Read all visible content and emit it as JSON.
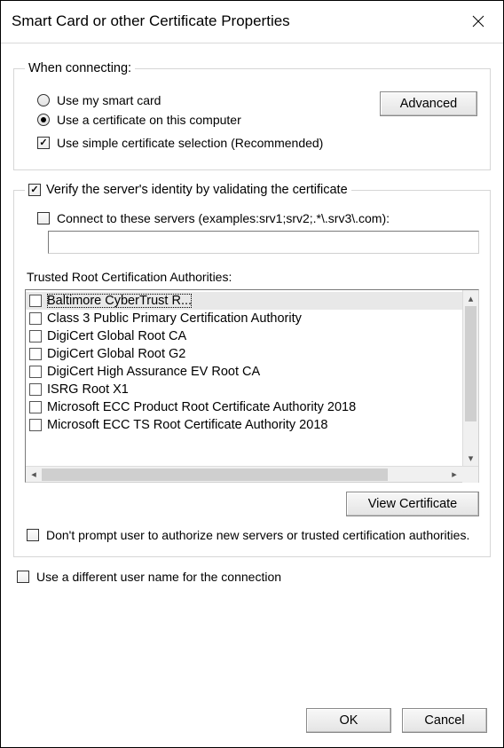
{
  "title": "Smart Card or other Certificate Properties",
  "connecting": {
    "legend": "When connecting:",
    "use_smart_card": "Use my smart card",
    "use_cert": "Use a certificate on this computer",
    "use_simple": "Use simple certificate selection (Recommended)",
    "advanced": "Advanced"
  },
  "verify": {
    "legend": "Verify the server's identity by validating the certificate",
    "connect_servers": "Connect to these servers (examples:srv1;srv2;.*\\.srv3\\.com):",
    "servers_value": "",
    "trusted_label": "Trusted Root Certification Authorities:",
    "items": [
      "Baltimore CyberTrust R...",
      "Class 3 Public Primary Certification Authority",
      "DigiCert Global Root CA",
      "DigiCert Global Root G2",
      "DigiCert High Assurance EV Root CA",
      "ISRG Root X1",
      "Microsoft ECC Product Root Certificate Authority 2018",
      "Microsoft ECC TS Root Certificate Authority 2018"
    ],
    "view_cert": "View Certificate",
    "no_prompt": "Don't prompt user to authorize new servers or trusted certification authorities."
  },
  "diff_user": "Use a different user name for the connection",
  "buttons": {
    "ok": "OK",
    "cancel": "Cancel"
  }
}
